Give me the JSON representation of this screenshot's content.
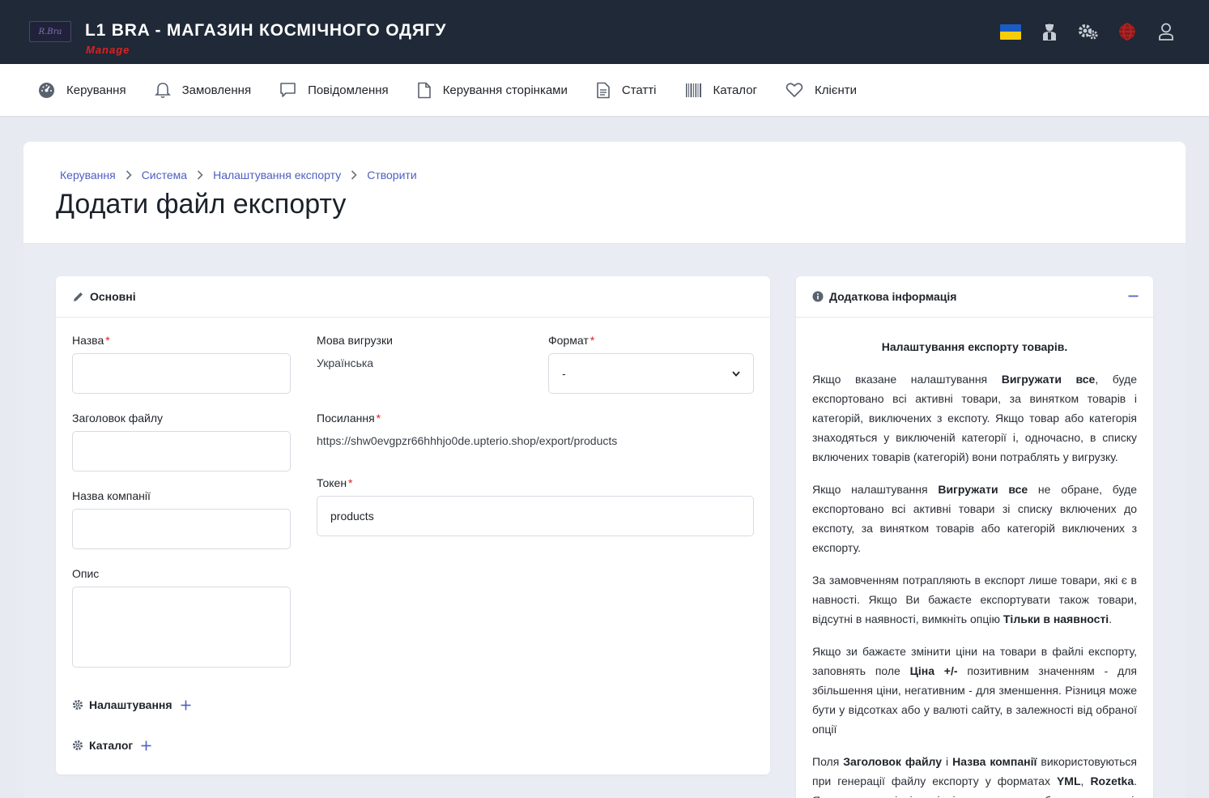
{
  "header": {
    "logo_text": "R.Bra",
    "title": "L1 BRA - МАГАЗИН КОСМІЧНОГО ОДЯГУ",
    "subtitle": "Manage"
  },
  "top_icons": [
    "ukraine-flag-icon",
    "support-agent-icon",
    "settings-gears-icon",
    "globe-icon",
    "user-icon"
  ],
  "nav": {
    "items": [
      {
        "label": "Керування",
        "icon": "dashboard-icon"
      },
      {
        "label": "Замовлення",
        "icon": "bell-icon"
      },
      {
        "label": "Повідомлення",
        "icon": "message-icon"
      },
      {
        "label": "Керування сторінками",
        "icon": "file-icon"
      },
      {
        "label": "Статті",
        "icon": "document-icon"
      },
      {
        "label": "Каталог",
        "icon": "barcode-icon"
      },
      {
        "label": "Клієнти",
        "icon": "heart-icon"
      }
    ]
  },
  "breadcrumb": [
    "Керування",
    "Система",
    "Налаштування експорту",
    "Створити"
  ],
  "page_title": "Додати файл експорту",
  "main_card": {
    "title": "Основні",
    "name_label": "Назва",
    "name_value": "",
    "file_title_label": "Заголовок файлу",
    "file_title_value": "",
    "company_label": "Назва компанії",
    "company_value": "",
    "description_label": "Опис",
    "description_value": "",
    "language_label": "Мова вигрузки",
    "language_value": "Українська",
    "link_label": "Посилання",
    "link_value": "https://shw0evgpzr66hhhjo0de.upterio.shop/export/products",
    "token_label": "Токен",
    "token_value": "products",
    "format_label": "Формат",
    "format_value": "-",
    "required_mark": "*",
    "settings_section": "Налаштування",
    "catalog_section": "Каталог"
  },
  "side_card": {
    "title": "Додаткова інформація",
    "heading": "Налаштування експорту товарів.",
    "p1": [
      "Якщо вказане налаштування ",
      "Вигружати все",
      ", буде експортовано всі активні товари, за винятком товарів і категорій, виключених з експоту. Якщо товар або категорія знаходяться у виключеній категорії і, одночасно, в списку включених товарів (категорій) вони потраблять у вигрузку."
    ],
    "p2": [
      "Якщо налаштування ",
      "Вигружати все",
      " не обране, буде експортовано всі активні товари зі списку включених до експоту, за винятком товарів або категорій виключених з експорту."
    ],
    "p3": [
      "За замовченням потрапляють в експорт лише товари, які є в навності. Якщо Ви бажаєте експортувати також товари, відсутні в наявності, вимкніть опцію ",
      "Тільки в наявності",
      "."
    ],
    "p4": [
      "Якщо зи бажаєте змінити ціни на товари в файлі експорту, заповнять поле ",
      "Ціна +/-",
      " позитивним значенням - для збільшення ціни, негативним - для зменшення. Різниця може бути у відсотках або у валюті сайту, в залежності від обраної опції"
    ],
    "p5": [
      "Поля ",
      "Заголовок файлу",
      " і ",
      "Назва компанії",
      " використовуються при генерації файлу експорту у форматах ",
      "YML",
      ", ",
      "Rozetka",
      ". Якщо не вказані, відповідні поля документу будуть заповнені"
    ]
  }
}
